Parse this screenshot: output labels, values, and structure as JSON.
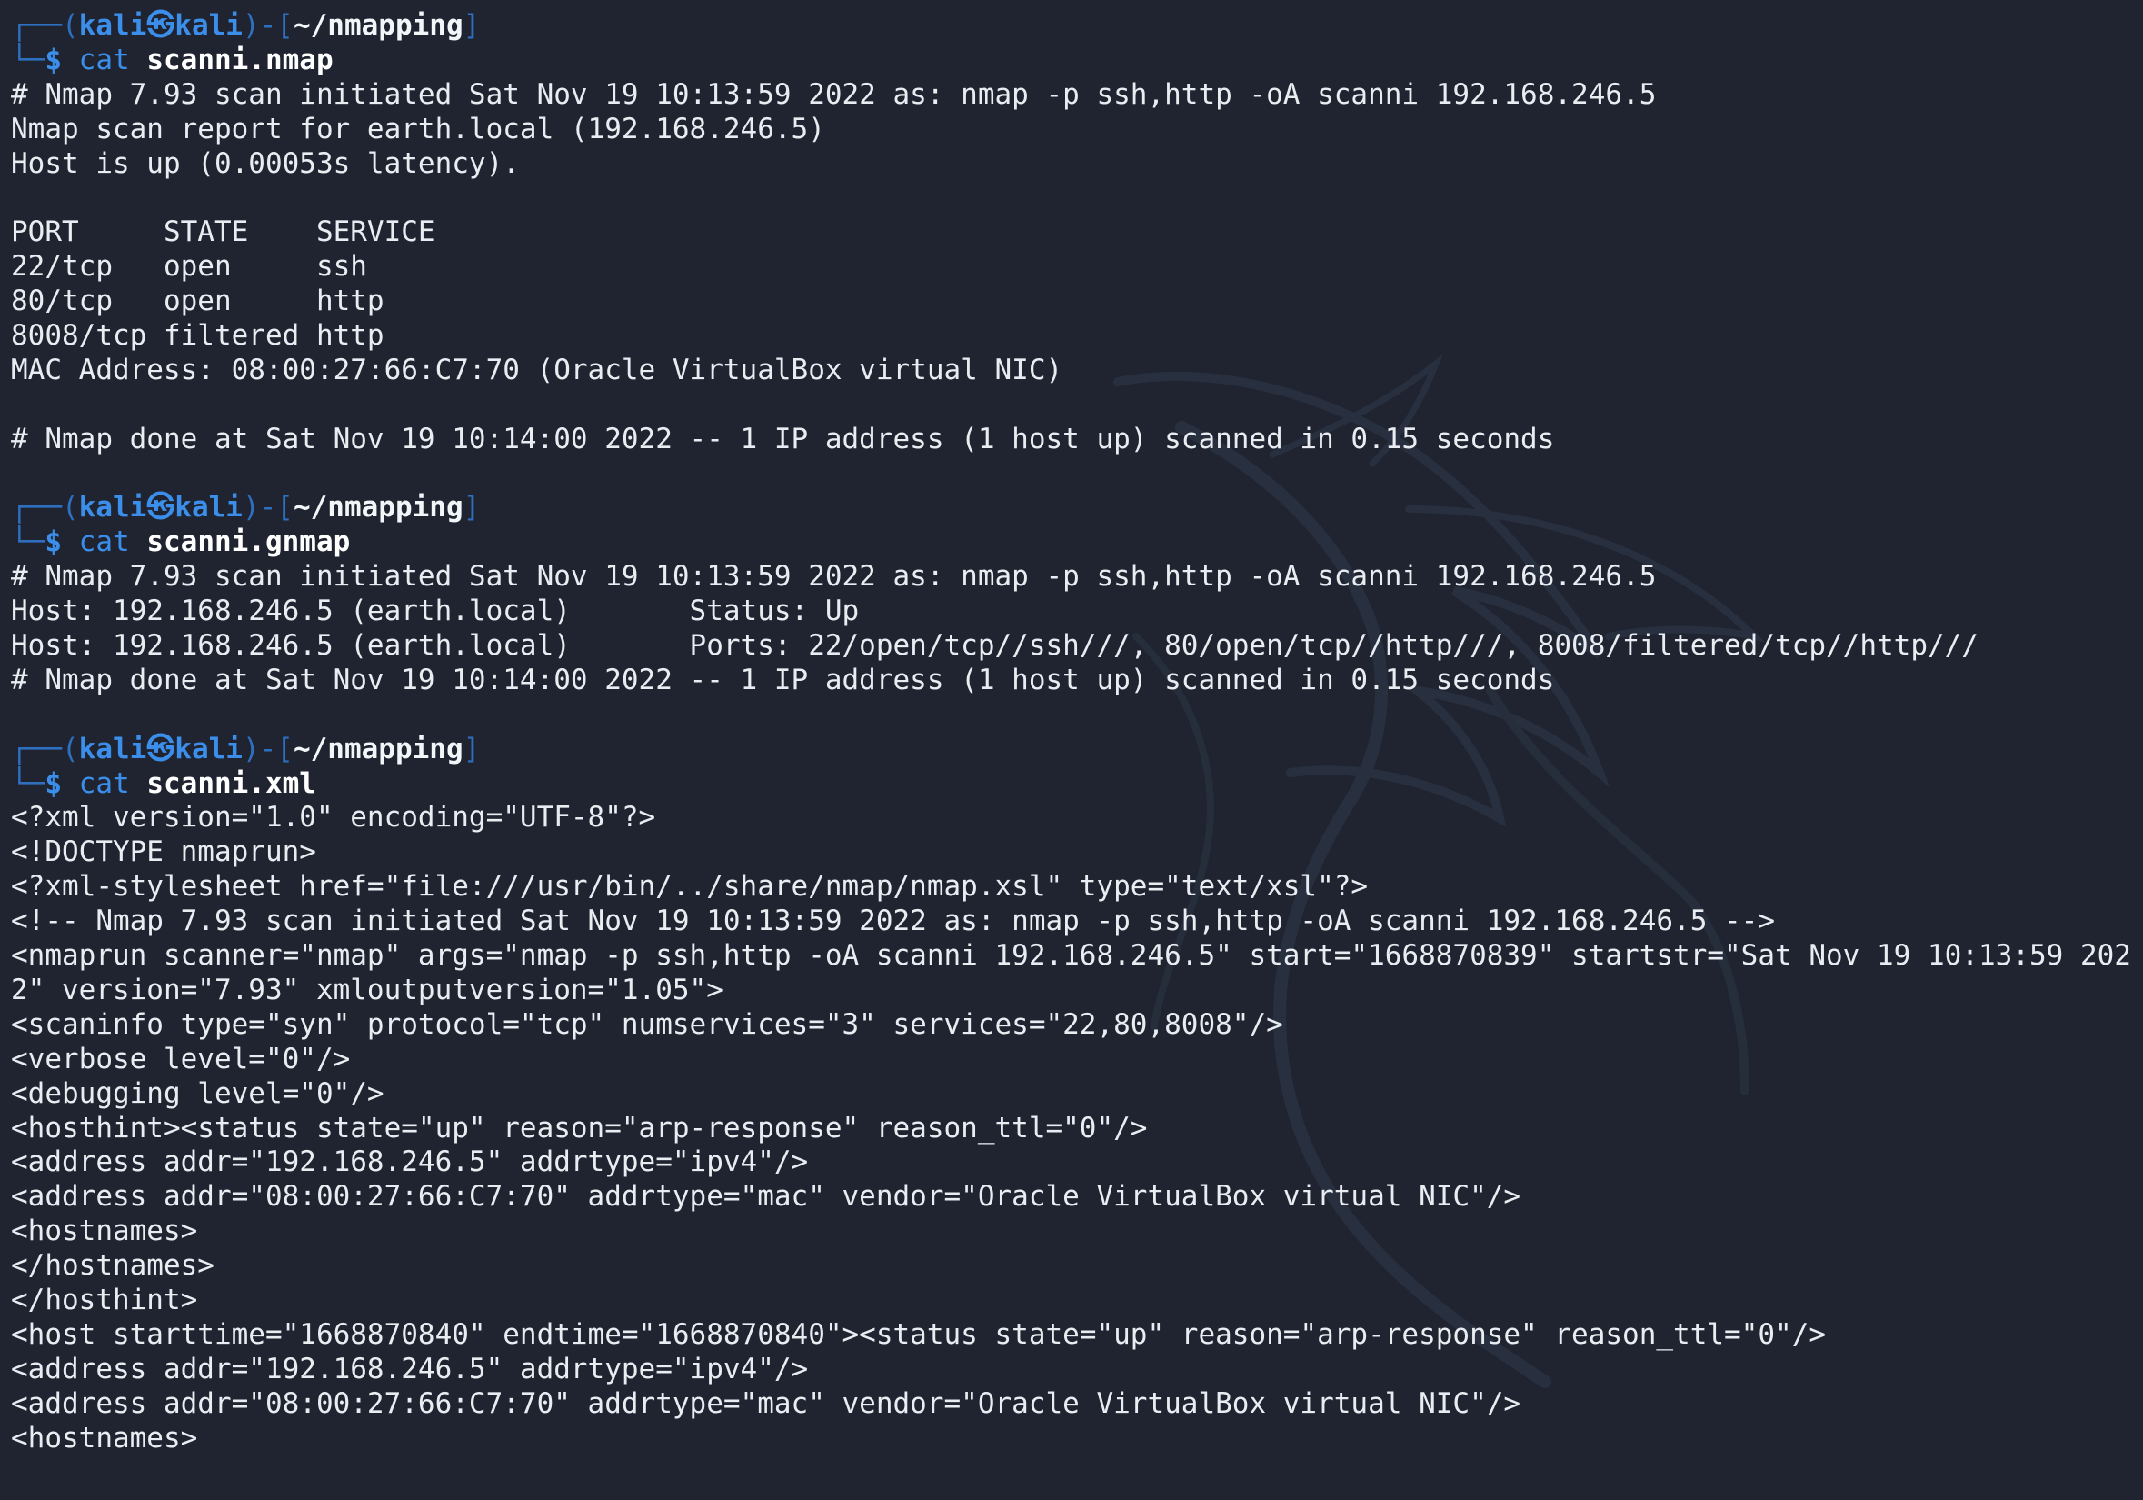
{
  "prompt": {
    "frame_open": "┌──(",
    "user": "kali㉿kali",
    "frame_mid": ")-[",
    "path": "~/nmapping",
    "frame_close": "]",
    "frame_bottom": "└─",
    "dollar": "$ "
  },
  "sessions": [
    {
      "command": "cat",
      "argument": "scanni.nmap",
      "output": [
        "# Nmap 7.93 scan initiated Sat Nov 19 10:13:59 2022 as: nmap -p ssh,http -oA scanni 192.168.246.5",
        "Nmap scan report for earth.local (192.168.246.5)",
        "Host is up (0.00053s latency).",
        "",
        "PORT     STATE    SERVICE",
        "22/tcp   open     ssh",
        "80/tcp   open     http",
        "8008/tcp filtered http",
        "MAC Address: 08:00:27:66:C7:70 (Oracle VirtualBox virtual NIC)",
        "",
        "# Nmap done at Sat Nov 19 10:14:00 2022 -- 1 IP address (1 host up) scanned in 0.15 seconds",
        ""
      ]
    },
    {
      "command": "cat",
      "argument": "scanni.gnmap",
      "output": [
        "# Nmap 7.93 scan initiated Sat Nov 19 10:13:59 2022 as: nmap -p ssh,http -oA scanni 192.168.246.5",
        "Host: 192.168.246.5 (earth.local)       Status: Up",
        "Host: 192.168.246.5 (earth.local)       Ports: 22/open/tcp//ssh///, 80/open/tcp//http///, 8008/filtered/tcp//http///",
        "# Nmap done at Sat Nov 19 10:14:00 2022 -- 1 IP address (1 host up) scanned in 0.15 seconds",
        ""
      ]
    },
    {
      "command": "cat",
      "argument": "scanni.xml",
      "output": [
        "<?xml version=\"1.0\" encoding=\"UTF-8\"?>",
        "<!DOCTYPE nmaprun>",
        "<?xml-stylesheet href=\"file:///usr/bin/../share/nmap/nmap.xsl\" type=\"text/xsl\"?>",
        "<!-- Nmap 7.93 scan initiated Sat Nov 19 10:13:59 2022 as: nmap -p ssh,http -oA scanni 192.168.246.5 -->",
        "<nmaprun scanner=\"nmap\" args=\"nmap -p ssh,http -oA scanni 192.168.246.5\" start=\"1668870839\" startstr=\"Sat Nov 19 10:13:59 202",
        "2\" version=\"7.93\" xmloutputversion=\"1.05\">",
        "<scaninfo type=\"syn\" protocol=\"tcp\" numservices=\"3\" services=\"22,80,8008\"/>",
        "<verbose level=\"0\"/>",
        "<debugging level=\"0\"/>",
        "<hosthint><status state=\"up\" reason=\"arp-response\" reason_ttl=\"0\"/>",
        "<address addr=\"192.168.246.5\" addrtype=\"ipv4\"/>",
        "<address addr=\"08:00:27:66:C7:70\" addrtype=\"mac\" vendor=\"Oracle VirtualBox virtual NIC\"/>",
        "<hostnames>",
        "</hostnames>",
        "</hosthint>",
        "<host starttime=\"1668870840\" endtime=\"1668870840\"><status state=\"up\" reason=\"arp-response\" reason_ttl=\"0\"/>",
        "<address addr=\"192.168.246.5\" addrtype=\"ipv4\"/>",
        "<address addr=\"08:00:27:66:C7:70\" addrtype=\"mac\" vendor=\"Oracle VirtualBox virtual NIC\"/>",
        "<hostnames>"
      ]
    }
  ],
  "colors": {
    "background": "#1f2430",
    "prompt_blue": "#3b8eea",
    "prompt_frame": "#2f6fbf",
    "text": "#e9edf2",
    "watermark": "#2a303d"
  },
  "icons": {
    "watermark": "kali-dragon-logo"
  }
}
